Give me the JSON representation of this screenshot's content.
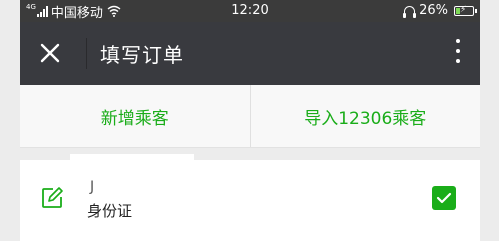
{
  "status_bar": {
    "network": "4G",
    "carrier": "中国移动",
    "time": "12:20",
    "battery_percent": "26%",
    "battery_level": 0.26,
    "icons": [
      "signal-icon",
      "wifi-icon",
      "headphone-icon",
      "battery-icon"
    ]
  },
  "header": {
    "title": "填写订单",
    "close_icon": "close-icon",
    "menu_icon": "more-vertical-icon"
  },
  "actions": {
    "add_passenger": "新增乘客",
    "import_12306": "导入12306乘客"
  },
  "passenger": {
    "name": "J",
    "id_type": "身份证",
    "selected": true
  },
  "colors": {
    "accent": "#1aad19",
    "header_bg": "#393a3f",
    "status_bg": "#3b3b3b"
  }
}
